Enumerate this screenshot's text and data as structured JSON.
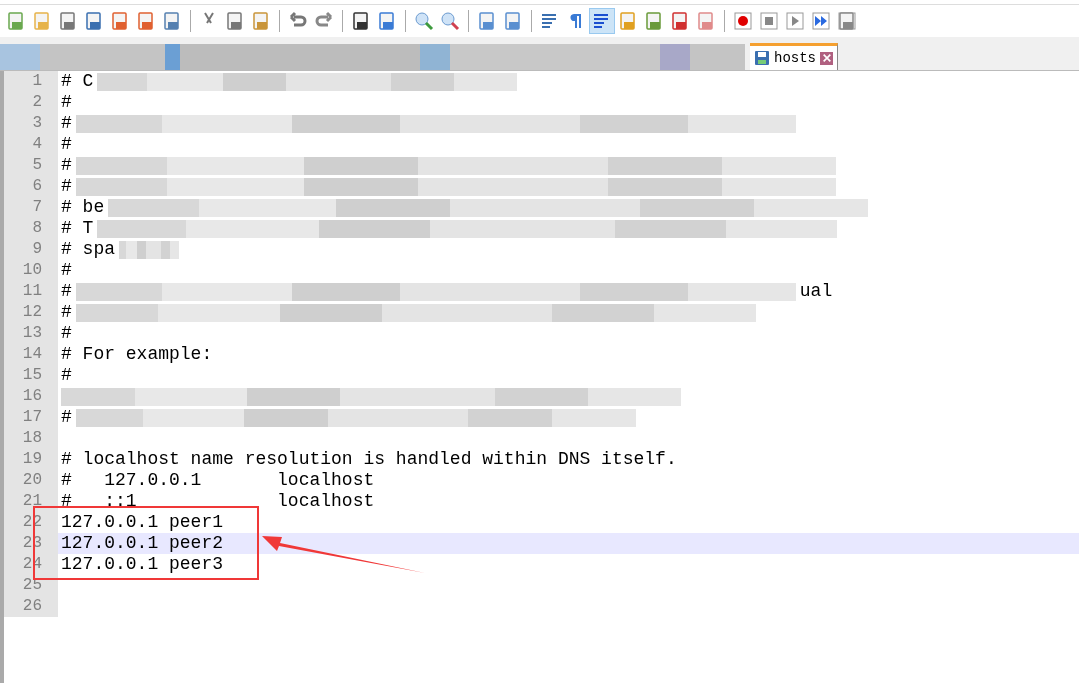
{
  "tabs": [
    {
      "label": "hosts",
      "selected": true,
      "modified": false
    }
  ],
  "lines": [
    {
      "number": "1",
      "text": "# C",
      "redacted": true,
      "current": false
    },
    {
      "number": "2",
      "text": "#",
      "redacted": false,
      "current": false
    },
    {
      "number": "3",
      "text": "#",
      "redacted": true,
      "current": false
    },
    {
      "number": "4",
      "text": "#",
      "redacted": false,
      "current": false
    },
    {
      "number": "5",
      "text": "#",
      "redacted": true,
      "current": false
    },
    {
      "number": "6",
      "text": "#",
      "redacted": true,
      "current": false
    },
    {
      "number": "7",
      "text": "# be",
      "redacted": true,
      "current": false
    },
    {
      "number": "8",
      "text": "# T",
      "redacted": true,
      "current": false
    },
    {
      "number": "9",
      "text": "# spa",
      "redacted": true,
      "current": false
    },
    {
      "number": "10",
      "text": "#",
      "redacted": false,
      "current": false
    },
    {
      "number": "11",
      "text": "#",
      "redacted": true,
      "tail": "ual",
      "current": false
    },
    {
      "number": "12",
      "text": "#",
      "redacted": true,
      "current": false
    },
    {
      "number": "13",
      "text": "#",
      "redacted": false,
      "current": false
    },
    {
      "number": "14",
      "text": "# For example:",
      "redacted": false,
      "current": false
    },
    {
      "number": "15",
      "text": "#",
      "redacted": false,
      "current": false
    },
    {
      "number": "16",
      "redacted": true,
      "current": false
    },
    {
      "number": "17",
      "text": "#",
      "redacted": true,
      "current": false
    },
    {
      "number": "18",
      "redacted": false,
      "current": false
    },
    {
      "number": "19",
      "text": "# localhost name resolution is handled within DNS itself.",
      "redacted": false,
      "current": false
    },
    {
      "number": "20",
      "text": "#   127.0.0.1       localhost",
      "redacted": false,
      "current": false
    },
    {
      "number": "21",
      "text": "#   ::1             localhost",
      "redacted": false,
      "current": false
    },
    {
      "number": "22",
      "text": "127.0.0.1 peer1",
      "redacted": false,
      "current": false
    },
    {
      "number": "23",
      "text": "127.0.0.1 peer2",
      "redacted": false,
      "current": true
    },
    {
      "number": "24",
      "text": "127.0.0.1 peer3",
      "redacted": false,
      "current": false
    },
    {
      "number": "25",
      "redacted": false,
      "current": false
    },
    {
      "number": "26",
      "redacted": false,
      "current": false
    }
  ]
}
